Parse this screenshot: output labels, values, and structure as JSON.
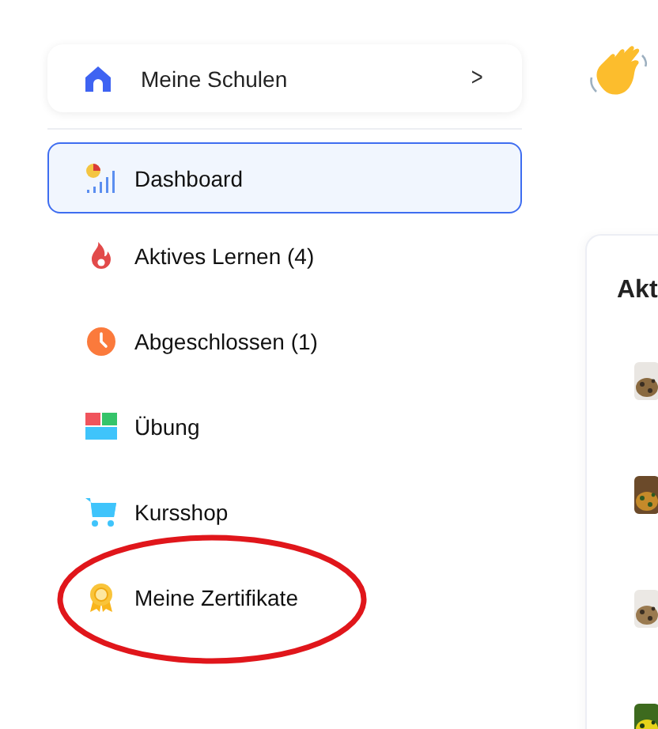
{
  "schools_button": {
    "label": "Meine Schulen",
    "chevron": ">"
  },
  "nav": [
    {
      "kind": "dashboard",
      "label": "Dashboard",
      "selected": true
    },
    {
      "kind": "flame",
      "label": "Aktives Lernen (4)",
      "selected": false
    },
    {
      "kind": "clock",
      "label": "Abgeschlossen (1)",
      "selected": false
    },
    {
      "kind": "tiles",
      "label": "Übung",
      "selected": false
    },
    {
      "kind": "cart",
      "label": "Kursshop",
      "selected": false
    },
    {
      "kind": "award",
      "label": "Meine Zertifikate",
      "selected": false,
      "circled": true
    }
  ],
  "main": {
    "heading": "Akt"
  }
}
